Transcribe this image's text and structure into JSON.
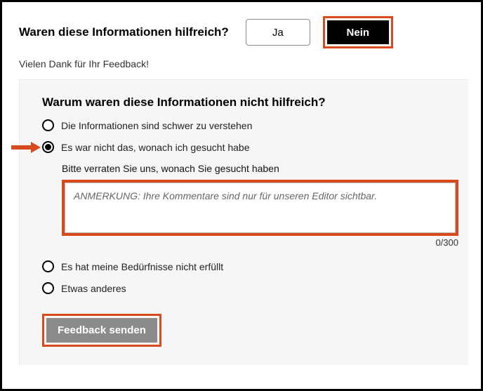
{
  "header": {
    "question": "Waren diese Informationen hilfreich?",
    "yes_label": "Ja",
    "no_label": "Nein"
  },
  "thankyou": "Vielen Dank für Ihr Feedback!",
  "panel": {
    "title": "Warum waren diese Informationen nicht hilfreich?",
    "options": {
      "hard_to_understand": "Die Informationen sind schwer zu verstehen",
      "not_what_looking_for": "Es war nicht das, wonach ich gesucht habe",
      "needs_not_met": "Es hat meine Bedürfnisse nicht erfüllt",
      "something_else": "Etwas anderes"
    },
    "sub": {
      "label": "Bitte verraten Sie uns, wonach Sie gesucht haben",
      "placeholder": "ANMERKUNG: Ihre Kommentare sind nur für unseren Editor sichtbar.",
      "char_count": "0/300"
    },
    "submit_label": "Feedback senden"
  },
  "colors": {
    "highlight_border": "#d8491e",
    "submit_bg": "#8b8b8b"
  }
}
